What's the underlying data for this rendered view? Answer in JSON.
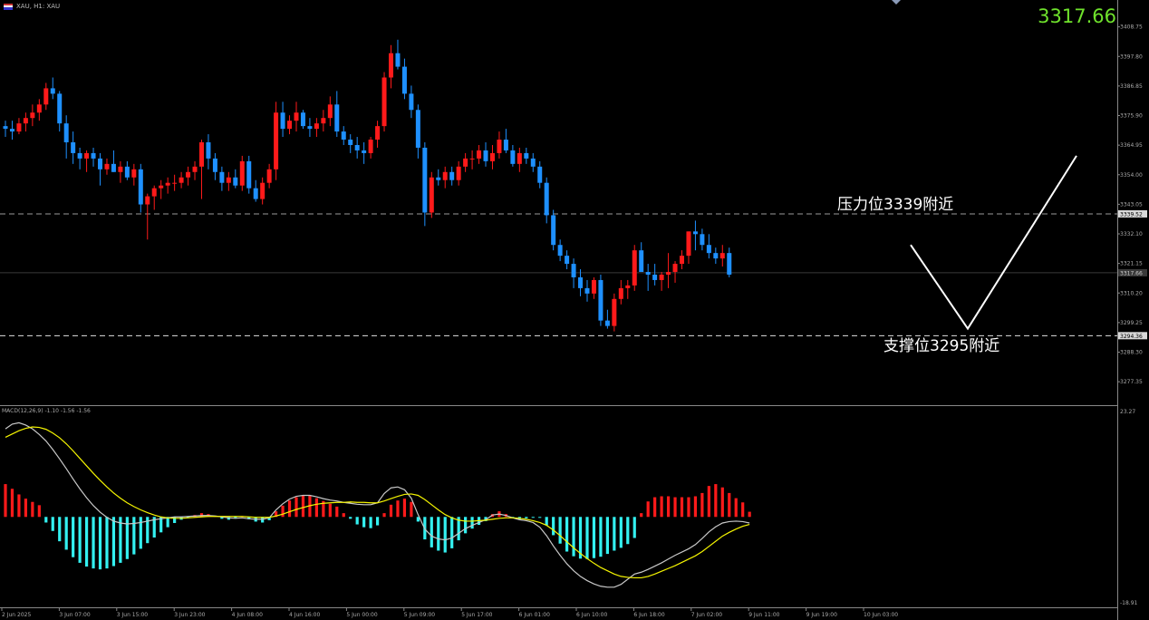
{
  "header": {
    "symbol_label": "XAU, H1: XAU",
    "current_price": "3317.66",
    "macd_label": "MACD(12,26,9) -1.10 -1.56 -1.56"
  },
  "annotations": {
    "resistance_text": "压力位3339附近",
    "support_text": "支撑位3295附近"
  },
  "colors": {
    "background": "#000000",
    "bull": "#ff1a1a",
    "bear": "#1e90ff",
    "hist_pos": "#ff1a1a",
    "hist_neg": "#33f0f0",
    "signal": "#f5f500",
    "macd_line": "#c8c8c8",
    "price_text": "#6fe22c",
    "projection": "#ffffff"
  },
  "chart_data": [
    {
      "type": "candlestick",
      "title": "XAU, H1",
      "price_axis_ticks": [
        "3408.75",
        "3397.80",
        "3386.85",
        "3375.90",
        "3364.95",
        "3354.00",
        "3343.05",
        "3332.10",
        "3321.15",
        "3310.20",
        "3299.25",
        "3288.30",
        "3277.35"
      ],
      "ylim": [
        3269,
        3414
      ],
      "time_axis_ticks": [
        "2 Jun 2025",
        "3 Jun 07:00",
        "3 Jun 15:00",
        "3 Jun 23:00",
        "4 Jun 08:00",
        "4 Jun 16:00",
        "5 Jun 00:00",
        "5 Jun 09:00",
        "5 Jun 17:00",
        "6 Jun 01:00",
        "6 Jun 10:00",
        "6 Jun 18:00",
        "7 Jun 02:00",
        "9 Jun 11:00",
        "9 Jun 19:00",
        "10 Jun 03:00"
      ],
      "price_markers": {
        "resistance": "3339.52",
        "current": "3317.66",
        "support": "3294.36"
      },
      "levels": {
        "resistance": 3339.5,
        "current": 3317.7,
        "support": 3294.4
      },
      "projection": [
        [
          1005,
          3328
        ],
        [
          1068,
          3297
        ],
        [
          1188,
          3361
        ]
      ],
      "ohlc": [
        [
          3372,
          3374,
          3368,
          3371
        ],
        [
          3371,
          3374,
          3367,
          3370
        ],
        [
          3370,
          3375,
          3369,
          3373
        ],
        [
          3373,
          3377,
          3370,
          3375
        ],
        [
          3375,
          3380,
          3372,
          3377
        ],
        [
          3377,
          3382,
          3374,
          3380
        ],
        [
          3380,
          3388,
          3378,
          3386
        ],
        [
          3386,
          3390,
          3382,
          3384
        ],
        [
          3384,
          3385,
          3370,
          3373
        ],
        [
          3373,
          3376,
          3360,
          3366
        ],
        [
          3366,
          3370,
          3358,
          3362
        ],
        [
          3362,
          3364,
          3356,
          3360
        ],
        [
          3360,
          3363,
          3355,
          3362
        ],
        [
          3362,
          3364,
          3357,
          3360
        ],
        [
          3360,
          3362,
          3350,
          3356
        ],
        [
          3356,
          3360,
          3354,
          3358
        ],
        [
          3358,
          3363,
          3355,
          3355
        ],
        [
          3355,
          3359,
          3351,
          3357
        ],
        [
          3357,
          3359,
          3352,
          3353
        ],
        [
          3353,
          3358,
          3350,
          3356
        ],
        [
          3356,
          3358,
          3340,
          3343
        ],
        [
          3343,
          3347,
          3330,
          3346
        ],
        [
          3346,
          3350,
          3341,
          3349
        ],
        [
          3349,
          3352,
          3345,
          3350
        ],
        [
          3350,
          3353,
          3347,
          3351
        ],
        [
          3351,
          3354,
          3348,
          3351
        ],
        [
          3351,
          3355,
          3349,
          3353
        ],
        [
          3353,
          3357,
          3350,
          3355
        ],
        [
          3355,
          3359,
          3352,
          3357
        ],
        [
          3357,
          3367,
          3345,
          3366
        ],
        [
          3366,
          3369,
          3356,
          3360
        ],
        [
          3360,
          3362,
          3352,
          3355
        ],
        [
          3355,
          3357,
          3348,
          3351
        ],
        [
          3351,
          3355,
          3348,
          3353
        ],
        [
          3353,
          3356,
          3349,
          3350
        ],
        [
          3350,
          3361,
          3348,
          3359
        ],
        [
          3359,
          3361,
          3347,
          3349
        ],
        [
          3349,
          3352,
          3344,
          3345
        ],
        [
          3345,
          3353,
          3343,
          3351
        ],
        [
          3351,
          3358,
          3349,
          3356
        ],
        [
          3356,
          3381,
          3352,
          3377
        ],
        [
          3377,
          3381,
          3368,
          3371
        ],
        [
          3371,
          3376,
          3369,
          3374
        ],
        [
          3374,
          3381,
          3370,
          3377
        ],
        [
          3377,
          3378,
          3371,
          3372
        ],
        [
          3372,
          3375,
          3368,
          3371
        ],
        [
          3371,
          3375,
          3368,
          3373
        ],
        [
          3373,
          3378,
          3370,
          3375
        ],
        [
          3375,
          3383,
          3372,
          3380
        ],
        [
          3380,
          3385,
          3368,
          3370
        ],
        [
          3370,
          3372,
          3365,
          3367
        ],
        [
          3367,
          3369,
          3362,
          3365
        ],
        [
          3365,
          3368,
          3360,
          3363
        ],
        [
          3363,
          3366,
          3358,
          3362
        ],
        [
          3362,
          3368,
          3360,
          3367
        ],
        [
          3367,
          3374,
          3364,
          3372
        ],
        [
          3372,
          3392,
          3370,
          3390
        ],
        [
          3390,
          3402,
          3386,
          3399
        ],
        [
          3399,
          3404,
          3393,
          3394
        ],
        [
          3394,
          3397,
          3382,
          3384
        ],
        [
          3384,
          3387,
          3375,
          3378
        ],
        [
          3378,
          3380,
          3360,
          3364
        ],
        [
          3364,
          3366,
          3335,
          3340
        ],
        [
          3340,
          3355,
          3338,
          3353
        ],
        [
          3353,
          3356,
          3350,
          3352
        ],
        [
          3352,
          3357,
          3349,
          3355
        ],
        [
          3355,
          3357,
          3350,
          3352
        ],
        [
          3352,
          3359,
          3350,
          3357
        ],
        [
          3357,
          3362,
          3355,
          3360
        ],
        [
          3360,
          3363,
          3356,
          3360
        ],
        [
          3360,
          3365,
          3358,
          3363
        ],
        [
          3363,
          3366,
          3357,
          3359
        ],
        [
          3359,
          3365,
          3356,
          3362
        ],
        [
          3362,
          3370,
          3360,
          3367
        ],
        [
          3367,
          3371,
          3362,
          3363
        ],
        [
          3363,
          3365,
          3357,
          3358
        ],
        [
          3358,
          3364,
          3355,
          3362
        ],
        [
          3362,
          3364,
          3358,
          3360
        ],
        [
          3360,
          3362,
          3355,
          3357
        ],
        [
          3357,
          3359,
          3349,
          3351
        ],
        [
          3351,
          3353,
          3336,
          3339
        ],
        [
          3339,
          3341,
          3326,
          3328
        ],
        [
          3328,
          3330,
          3322,
          3324
        ],
        [
          3324,
          3326,
          3319,
          3321
        ],
        [
          3321,
          3323,
          3312,
          3316
        ],
        [
          3316,
          3319,
          3309,
          3312
        ],
        [
          3312,
          3315,
          3307,
          3310
        ],
        [
          3310,
          3316,
          3308,
          3315
        ],
        [
          3315,
          3317,
          3298,
          3300
        ],
        [
          3300,
          3304,
          3297,
          3298
        ],
        [
          3298,
          3310,
          3296,
          3308
        ],
        [
          3308,
          3315,
          3306,
          3312
        ],
        [
          3312,
          3315,
          3308,
          3313
        ],
        [
          3313,
          3328,
          3311,
          3326
        ],
        [
          3326,
          3329,
          3318,
          3318
        ],
        [
          3318,
          3321,
          3311,
          3317
        ],
        [
          3317,
          3321,
          3313,
          3315
        ],
        [
          3315,
          3318,
          3311,
          3317
        ],
        [
          3317,
          3325,
          3312,
          3318
        ],
        [
          3318,
          3322,
          3314,
          3321
        ],
        [
          3321,
          3326,
          3319,
          3324
        ],
        [
          3324,
          3333,
          3321,
          3333
        ],
        [
          3333,
          3337,
          3326,
          3332
        ],
        [
          3332,
          3334,
          3326,
          3328
        ],
        [
          3328,
          3332,
          3323,
          3325
        ],
        [
          3325,
          3327,
          3321,
          3323
        ],
        [
          3323,
          3328,
          3320,
          3325
        ],
        [
          3325,
          3327,
          3316,
          3317
        ]
      ]
    },
    {
      "type": "macd",
      "title": "MACD(12,26,9)",
      "axis_ticks": [
        "23.27",
        "-18.91"
      ],
      "ylim": [
        -18.91,
        23.27
      ],
      "histogram": [
        7.0,
        6.0,
        4.8,
        3.9,
        3.2,
        2.5,
        -1.2,
        -3.0,
        -5.2,
        -7.0,
        -8.6,
        -9.8,
        -10.6,
        -11.0,
        -11.2,
        -11.0,
        -10.5,
        -9.8,
        -9.0,
        -8.0,
        -6.8,
        -5.6,
        -4.4,
        -3.3,
        -2.2,
        -1.3,
        -0.6,
        -0.2,
        0.4,
        0.8,
        0.6,
        0.2,
        -0.4,
        -0.6,
        -0.3,
        0.2,
        -0.5,
        -1.0,
        -1.2,
        -0.7,
        1.2,
        2.4,
        3.5,
        4.2,
        4.6,
        4.6,
        4.0,
        3.4,
        2.8,
        2.2,
        0.8,
        -0.4,
        -1.6,
        -2.2,
        -2.4,
        -1.8,
        0.8,
        2.6,
        3.5,
        3.9,
        3.2,
        -1.0,
        -4.8,
        -6.5,
        -7.2,
        -7.6,
        -6.7,
        -5.0,
        -3.5,
        -2.5,
        -1.7,
        -0.9,
        0.6,
        1.2,
        0.6,
        -0.2,
        -0.5,
        -0.3,
        -0.1,
        -0.2,
        -1.8,
        -3.9,
        -5.7,
        -7.4,
        -8.4,
        -8.9,
        -9.0,
        -8.8,
        -8.5,
        -7.9,
        -7.2,
        -6.6,
        -5.8,
        -4.5,
        0.8,
        3.3,
        4.2,
        4.4,
        4.4,
        4.2,
        4.2,
        4.2,
        4.4,
        5.1,
        6.6,
        7.0,
        6.3,
        5.1,
        4.0,
        3.1,
        1.1
      ],
      "macd_line": [
        18.8,
        19.8,
        20.1,
        19.6,
        18.8,
        17.6,
        16.2,
        14.4,
        12.4,
        10.3,
        8.1,
        6.0,
        4.1,
        2.4,
        1.0,
        -0.1,
        -0.9,
        -1.3,
        -1.5,
        -1.4,
        -1.2,
        -0.9,
        -0.6,
        -0.4,
        -0.2,
        0.0,
        0.0,
        0.1,
        0.2,
        0.3,
        0.3,
        0.2,
        0.0,
        -0.2,
        -0.3,
        -0.2,
        -0.4,
        -0.5,
        -0.5,
        -0.2,
        1.5,
        2.8,
        3.8,
        4.4,
        4.6,
        4.6,
        4.3,
        3.9,
        3.6,
        3.4,
        3.1,
        2.9,
        2.7,
        2.6,
        2.6,
        3.0,
        5.0,
        6.2,
        6.4,
        5.8,
        4.0,
        0.5,
        -2.6,
        -4.1,
        -4.7,
        -4.9,
        -4.5,
        -3.5,
        -2.5,
        -1.8,
        -1.2,
        -0.6,
        0.4,
        0.6,
        0.3,
        -0.2,
        -0.6,
        -0.8,
        -1.2,
        -2.2,
        -4.0,
        -6.2,
        -8.2,
        -10.0,
        -11.5,
        -12.7,
        -13.6,
        -14.3,
        -14.8,
        -15.0,
        -15.0,
        -14.4,
        -13.3,
        -12.2,
        -11.8,
        -11.2,
        -10.5,
        -9.8,
        -9.0,
        -8.2,
        -7.5,
        -6.8,
        -5.9,
        -4.6,
        -3.2,
        -2.1,
        -1.3,
        -1.0,
        -0.9,
        -1.0,
        -1.3
      ],
      "signal_line": [
        17.0,
        17.7,
        18.4,
        18.9,
        19.2,
        19.1,
        18.7,
        17.9,
        16.9,
        15.6,
        14.1,
        12.5,
        10.9,
        9.3,
        7.8,
        6.4,
        5.1,
        4.0,
        3.0,
        2.2,
        1.5,
        0.9,
        0.4,
        0.0,
        -0.2,
        -0.3,
        -0.3,
        -0.2,
        -0.1,
        0.0,
        0.1,
        0.1,
        0.1,
        0.1,
        0.1,
        0.1,
        0.0,
        -0.1,
        -0.1,
        -0.1,
        0.2,
        0.6,
        1.1,
        1.6,
        2.0,
        2.4,
        2.7,
        2.9,
        3.0,
        3.1,
        3.1,
        3.2,
        3.1,
        3.1,
        3.0,
        3.0,
        3.4,
        3.9,
        4.4,
        4.8,
        4.9,
        4.6,
        3.7,
        2.6,
        1.5,
        0.5,
        -0.2,
        -0.7,
        -0.9,
        -0.9,
        -0.8,
        -0.7,
        -0.5,
        -0.3,
        -0.2,
        -0.2,
        -0.3,
        -0.5,
        -0.8,
        -1.2,
        -1.8,
        -2.8,
        -4.0,
        -5.3,
        -6.6,
        -7.8,
        -8.9,
        -9.9,
        -10.8,
        -11.5,
        -12.2,
        -12.7,
        -12.9,
        -13.0,
        -13.0,
        -12.7,
        -12.2,
        -11.6,
        -11.0,
        -10.4,
        -9.7,
        -9.0,
        -8.3,
        -7.4,
        -6.3,
        -5.2,
        -4.1,
        -3.3,
        -2.6,
        -2.0,
        -1.6
      ]
    }
  ]
}
